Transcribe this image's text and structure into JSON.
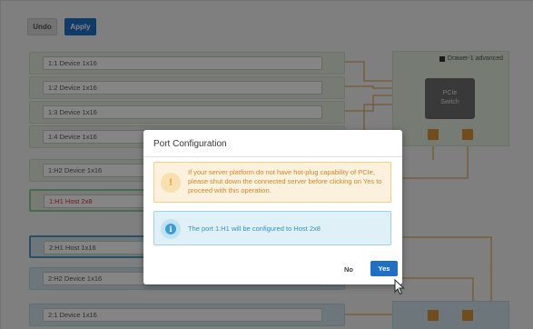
{
  "toolbar": {
    "undo_label": "Undo",
    "apply_label": "Apply"
  },
  "rows": [
    {
      "label": "1:1 Device 1x16"
    },
    {
      "label": "1:2 Device 1x16"
    },
    {
      "label": "1:3 Device 1x16"
    },
    {
      "label": "1:4 Device 1x16"
    },
    {
      "label": "1:H2 Device 1x16"
    },
    {
      "label": "1:H1 Host 2x8"
    },
    {
      "label": "2:H1 Host 1x16"
    },
    {
      "label": "2:H2 Device 1x16"
    },
    {
      "label": "2:1 Device 1x16"
    }
  ],
  "drawer": {
    "label": "Drawer-1 advanced"
  },
  "switch": {
    "line1": "PCIe",
    "line2": "Switch"
  },
  "modal": {
    "title": "Port Configuration",
    "warning_text": "If your server platform do not have hot-plug capability of PCIe, please shut down the connected server before clicking on Yes to proceed with this operation.",
    "warning_icon": "!",
    "info_text": "The port 1:H1 will be configured to Host 2x8",
    "info_icon": "i",
    "no_label": "No",
    "yes_label": "Yes"
  },
  "colors": {
    "primary": "#1f6fc5",
    "warning": "#d0882d",
    "info": "#3a8ec0",
    "error_text": "#d8342d",
    "port": "#d9953b"
  }
}
